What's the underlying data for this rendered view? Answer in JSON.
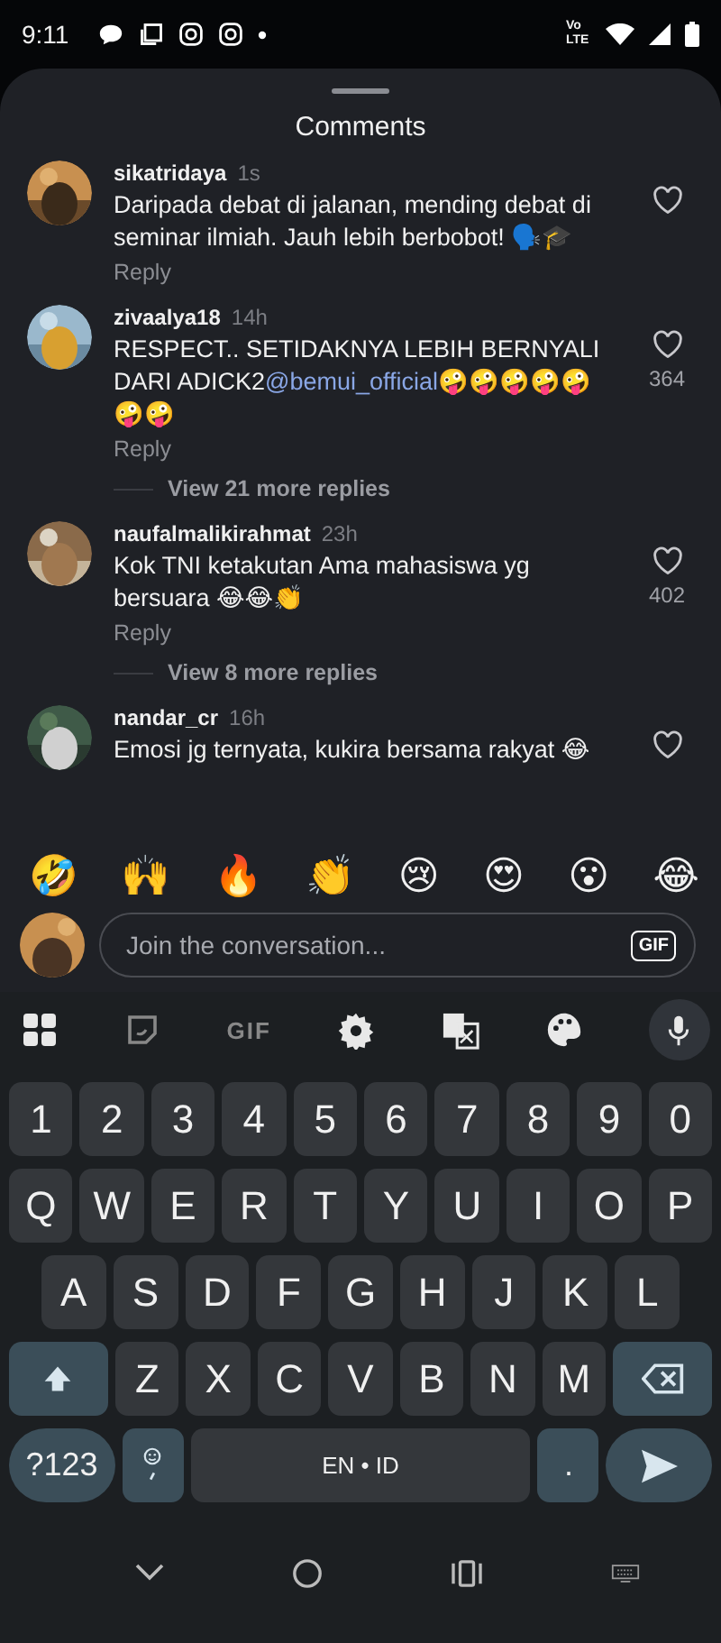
{
  "status_bar": {
    "time": "9:11",
    "network": "Vo LTE"
  },
  "sheet": {
    "title": "Comments"
  },
  "comments": [
    {
      "user": "sikatridaya",
      "time": "1s",
      "text": "Daripada debat di jalanan, mending debat di seminar ilmiah. Jauh lebih berbobot! 🗣️🎓",
      "reply": "Reply"
    },
    {
      "user": "zivaalya18",
      "time": "14h",
      "text": "RESPECT.. SETIDAKNYA LEBIH BERNYALI DARI ADICK2",
      "mention": "@bemui_official",
      "after": "🤪🤪🤪🤪🤪🤪🤪",
      "likes": "364",
      "reply": "Reply",
      "view_replies": "View 21 more replies"
    },
    {
      "user": "naufalmalikirahmat",
      "time": "23h",
      "text": "Kok TNI ketakutan Ama mahasiswa yg bersuara 😂😂👏",
      "likes": "402",
      "reply": "Reply",
      "view_replies": "View 8 more replies"
    },
    {
      "user": "nandar_cr",
      "time": "16h",
      "text": "Emosi jg ternyata, kukira bersama rakyat 😂"
    }
  ],
  "reactions": [
    "🤣",
    "🙌",
    "🔥",
    "👏",
    "😢",
    "😍",
    "😮",
    "😂"
  ],
  "composer": {
    "placeholder": "Join the conversation...",
    "gif": "GIF"
  },
  "keyboard": {
    "toolbar": [
      {
        "kind": "apps"
      },
      {
        "kind": "sticker"
      },
      {
        "kind": "gif",
        "label": "GIF"
      },
      {
        "kind": "settings"
      },
      {
        "kind": "translate"
      },
      {
        "kind": "palette"
      },
      {
        "kind": "mic"
      }
    ],
    "rows": [
      [
        {
          "kind": "char",
          "label": "1"
        },
        {
          "kind": "char",
          "label": "2"
        },
        {
          "kind": "char",
          "label": "3"
        },
        {
          "kind": "char",
          "label": "4"
        },
        {
          "kind": "char",
          "label": "5"
        },
        {
          "kind": "char",
          "label": "6"
        },
        {
          "kind": "char",
          "label": "7"
        },
        {
          "kind": "char",
          "label": "8"
        },
        {
          "kind": "char",
          "label": "9"
        },
        {
          "kind": "char",
          "label": "0"
        }
      ],
      [
        {
          "kind": "char",
          "label": "Q"
        },
        {
          "kind": "char",
          "label": "W"
        },
        {
          "kind": "char",
          "label": "E"
        },
        {
          "kind": "char",
          "label": "R"
        },
        {
          "kind": "char",
          "label": "T"
        },
        {
          "kind": "char",
          "label": "Y"
        },
        {
          "kind": "char",
          "label": "U"
        },
        {
          "kind": "char",
          "label": "I"
        },
        {
          "kind": "char",
          "label": "O"
        },
        {
          "kind": "char",
          "label": "P"
        }
      ],
      [
        {
          "kind": "char",
          "label": "A"
        },
        {
          "kind": "char",
          "label": "S"
        },
        {
          "kind": "char",
          "label": "D"
        },
        {
          "kind": "char",
          "label": "F"
        },
        {
          "kind": "char",
          "label": "G"
        },
        {
          "kind": "char",
          "label": "H"
        },
        {
          "kind": "char",
          "label": "J"
        },
        {
          "kind": "char",
          "label": "K"
        },
        {
          "kind": "char",
          "label": "L"
        }
      ],
      [
        {
          "kind": "shift"
        },
        {
          "kind": "char",
          "label": "Z"
        },
        {
          "kind": "char",
          "label": "X"
        },
        {
          "kind": "char",
          "label": "C"
        },
        {
          "kind": "char",
          "label": "V"
        },
        {
          "kind": "char",
          "label": "B"
        },
        {
          "kind": "char",
          "label": "N"
        },
        {
          "kind": "char",
          "label": "M"
        },
        {
          "kind": "backspace"
        }
      ],
      [
        {
          "kind": "symbols",
          "label": "?123"
        },
        {
          "kind": "emoji"
        },
        {
          "kind": "space",
          "label": "EN • ID"
        },
        {
          "kind": "period",
          "label": "."
        },
        {
          "kind": "enter"
        }
      ]
    ]
  }
}
